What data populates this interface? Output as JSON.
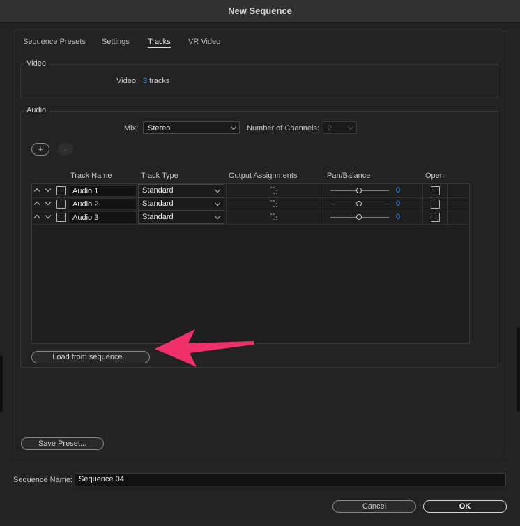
{
  "window": {
    "title": "New Sequence"
  },
  "tabs": [
    {
      "label": "Sequence Presets",
      "active": false
    },
    {
      "label": "Settings",
      "active": false
    },
    {
      "label": "Tracks",
      "active": true
    },
    {
      "label": "VR Video",
      "active": false
    }
  ],
  "video": {
    "group_title": "Video",
    "label": "Video:",
    "track_count": "3",
    "tracks_word": "tracks"
  },
  "audio": {
    "group_title": "Audio",
    "mix_label": "Mix:",
    "mix_value": "Stereo",
    "channels_label": "Number of Channels:",
    "channels_value": "2",
    "add_symbol": "+",
    "remove_symbol": "-",
    "columns": {
      "track_name": "Track Name",
      "track_type": "Track Type",
      "output_assignments": "Output Assignments",
      "pan_balance": "Pan/Balance",
      "open": "Open"
    },
    "tracks": [
      {
        "name": "Audio 1",
        "type": "Standard",
        "pan": "0"
      },
      {
        "name": "Audio 2",
        "type": "Standard",
        "pan": "0"
      },
      {
        "name": "Audio 3",
        "type": "Standard",
        "pan": "0"
      }
    ],
    "load_button": "Load from sequence..."
  },
  "footer": {
    "save_preset": "Save Preset...",
    "sequence_name_label": "Sequence Name:",
    "sequence_name_value": "Sequence 04",
    "cancel": "Cancel",
    "ok": "OK"
  },
  "colors": {
    "accent_blue": "#3b9cff",
    "annotation_arrow": "#f0306b"
  }
}
